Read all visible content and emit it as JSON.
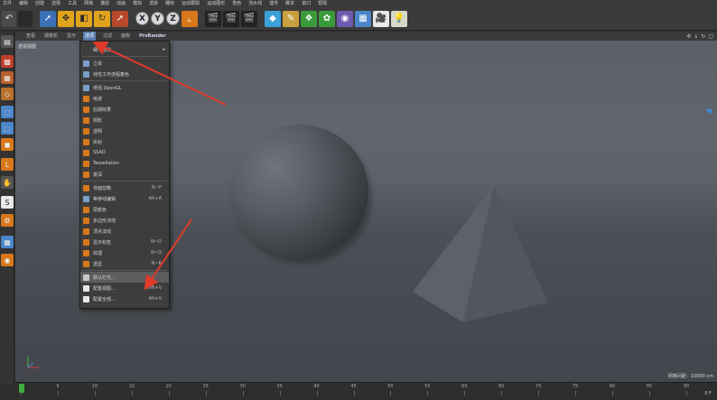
{
  "menubar": {
    "items": [
      "文件",
      "编辑",
      "创建",
      "选择",
      "工具",
      "网格",
      "捕捉",
      "动画",
      "模拟",
      "渲染",
      "雕刻",
      "运动跟踪",
      "运动图形",
      "角色",
      "流水线",
      "插件",
      "脚本",
      "窗口",
      "帮助"
    ]
  },
  "toolbar": {
    "axis_x": "X",
    "axis_y": "Y",
    "axis_z": "Z"
  },
  "viewport": {
    "tabs": [
      "查看",
      "摄像机",
      "显示",
      "选项",
      "过滤",
      "面板",
      "ProRender"
    ],
    "active_tab_index": 3,
    "label": "透视视图",
    "grid_readout": "网格间距：10000 cm"
  },
  "dropdown": {
    "items": [
      {
        "label": "细节级别",
        "shortcut": "",
        "submenu": true,
        "icon_color": "#3d3d3d"
      },
      {
        "label": "立体",
        "shortcut": "",
        "icon_color": "#7a9fc8"
      },
      {
        "label": "线性工作流程着色",
        "shortcut": "",
        "icon_color": "#7a9fc8"
      },
      {
        "label": "增强 OpenGL",
        "shortcut": "",
        "icon_color": "#7a9fc8"
      },
      {
        "label": "噪波",
        "shortcut": "",
        "icon_color": "#d9781a"
      },
      {
        "label": "后期效果",
        "shortcut": "",
        "icon_color": "#d9781a"
      },
      {
        "label": "阴影",
        "shortcut": "",
        "icon_color": "#d9781a"
      },
      {
        "label": "透明",
        "shortcut": "",
        "icon_color": "#d9781a"
      },
      {
        "label": "反射",
        "shortcut": "",
        "icon_color": "#d9781a"
      },
      {
        "label": "SSAO",
        "shortcut": "",
        "icon_color": "#d9781a"
      },
      {
        "label": "Tessellation",
        "shortcut": "",
        "icon_color": "#d9781a"
      },
      {
        "label": "景深",
        "shortcut": "",
        "icon_color": "#d9781a"
      },
      {
        "label": "背面忽略",
        "shortcut": "N~P",
        "icon_color": "#d9781a"
      },
      {
        "label": "等参线编辑",
        "shortcut": "Alt+A",
        "icon_color": "#7a9fc8"
      },
      {
        "label": "层颜色",
        "shortcut": "",
        "icon_color": "#d9781a"
      },
      {
        "label": "多边形法线",
        "shortcut": "",
        "icon_color": "#d9781a"
      },
      {
        "label": "顶点法线",
        "shortcut": "",
        "icon_color": "#d9781a"
      },
      {
        "label": "显示标签",
        "shortcut": "N~O",
        "icon_color": "#d9781a"
      },
      {
        "label": "纹理",
        "shortcut": "N~Q",
        "icon_color": "#d9781a"
      },
      {
        "label": "透显",
        "shortcut": "N~R",
        "icon_color": "#d9781a"
      },
      {
        "label": "默认灯光...",
        "shortcut": "",
        "icon_color": "#c8c8c8"
      },
      {
        "label": "配置视图...",
        "shortcut": "Shift+V",
        "icon_color": "#e8e8e8"
      },
      {
        "label": "配置全部...",
        "shortcut": "Alt+V",
        "icon_color": "#e8e8e8"
      }
    ],
    "highlighted_index": 20
  },
  "timeline": {
    "ticks": [
      "0",
      "5",
      "10",
      "15",
      "20",
      "25",
      "30",
      "35",
      "40",
      "45",
      "50",
      "55",
      "60",
      "65",
      "70",
      "75",
      "80",
      "85",
      "90"
    ],
    "frame_readout": "0 F"
  }
}
